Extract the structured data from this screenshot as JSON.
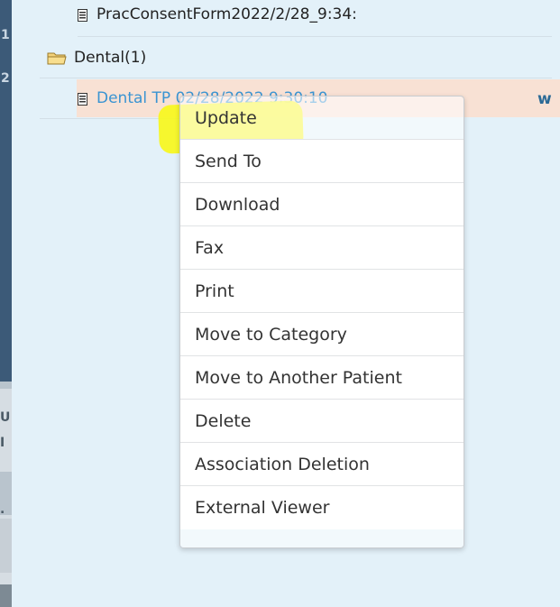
{
  "tree": {
    "row_top_label": "PracConsentForm2022/2/28_9:34:",
    "folder_label": "Dental(1)",
    "selected_label": "Dental TP 02/28/2022 9:30:10",
    "right_marker": "w"
  },
  "left_strip_glyphs": [
    "1",
    "2"
  ],
  "left_lower_glyphs": [
    "U",
    "I",
    "."
  ],
  "context_menu": {
    "items": [
      "Update",
      "Send To",
      "Download",
      "Fax",
      "Print",
      "Move to Category",
      "Move to Another Patient",
      "Delete",
      "Association Deletion",
      "External Viewer"
    ],
    "highlighted_item": "Update",
    "highlight_color": "#f7f71c"
  },
  "icons": {
    "document": "document-icon",
    "folder": "folder-open-icon"
  },
  "colors": {
    "background": "#e3f1f9",
    "selected_row": "#f8e1d4",
    "link": "#3a94d2",
    "left_strip": "#3c5a78"
  }
}
